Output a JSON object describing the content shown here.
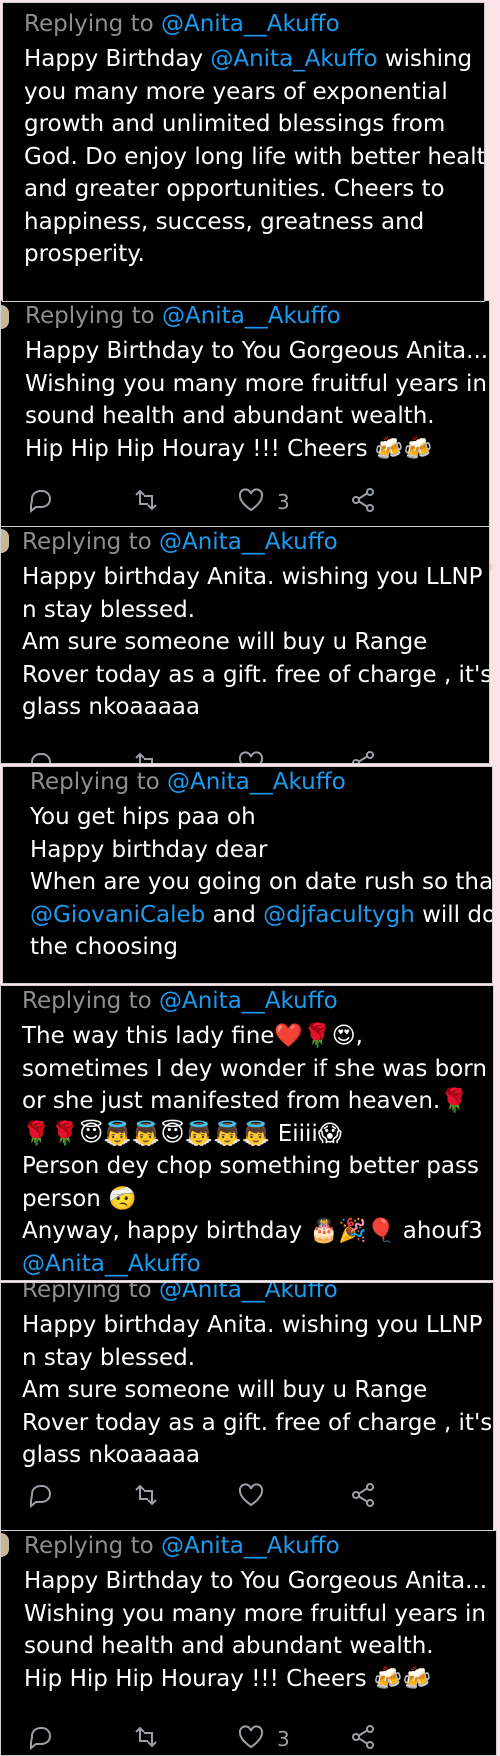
{
  "reply_prefix": "Replying to",
  "tweets": [
    {
      "handle": "@Anita__Akuffo",
      "lines": [
        [
          {
            "t": "Happy Birthday "
          },
          {
            "t": "@Anita_Akuffo",
            "m": true
          },
          {
            "t": " wishing"
          }
        ],
        [
          {
            "t": "you many more years of exponential"
          }
        ],
        [
          {
            "t": "growth and unlimited blessings from"
          }
        ],
        [
          {
            "t": "God. Do enjoy long life with better health"
          }
        ],
        [
          {
            "t": "and greater opportunities. Cheers to"
          }
        ],
        [
          {
            "t": "happiness, success, greatness and"
          }
        ],
        [
          {
            "t": "prosperity."
          }
        ]
      ]
    },
    {
      "handle": "@Anita__Akuffo",
      "lines": [
        [
          {
            "t": "Happy Birthday to You Gorgeous Anita..."
          }
        ],
        [
          {
            "t": "Wishing you many more fruitful years in"
          }
        ],
        [
          {
            "t": "sound health and abundant wealth."
          }
        ],
        [
          {
            "t": "Hip Hip Hip Houray !!! Cheers 🍻🍻"
          }
        ]
      ],
      "like_count": "3"
    },
    {
      "handle": "@Anita__Akuffo",
      "lines": [
        [
          {
            "t": "Happy birthday Anita. wishing you LLNP"
          }
        ],
        [
          {
            "t": "n stay blessed."
          }
        ],
        [
          {
            "t": "Am sure someone will buy u Range"
          }
        ],
        [
          {
            "t": "Rover today as a gift. free of charge , it's"
          }
        ],
        [
          {
            "t": "glass nkoaaaaa"
          }
        ]
      ]
    },
    {
      "handle": "@Anita__Akuffo",
      "lines": [
        [
          {
            "t": "You get hips paa oh"
          }
        ],
        [
          {
            "t": "Happy birthday dear"
          }
        ],
        [
          {
            "t": "When are you going on date rush so that"
          }
        ],
        [
          {
            "t": "@GiovaniCaleb",
            "m": true
          },
          {
            "t": " and "
          },
          {
            "t": "@djfacultygh",
            "m": true
          },
          {
            "t": " will do"
          }
        ],
        [
          {
            "t": "the choosing"
          }
        ]
      ]
    },
    {
      "handle": "@Anita__Akuffo",
      "lines": [
        [
          {
            "t": "The way this lady fine❤️🌹😍,"
          }
        ],
        [
          {
            "t": "sometimes I dey wonder if she was born"
          }
        ],
        [
          {
            "t": "or she just manifested from heaven.🌹"
          }
        ],
        [
          {
            "t": "🌹🌹😇👼👼😇👼👼👼 Eiiii😱"
          }
        ],
        [
          {
            "t": "Person dey chop something better pass"
          }
        ],
        [
          {
            "t": "person 🤕"
          }
        ],
        [
          {
            "t": "Anyway, happy birthday 🎂🎉🎈 ahouf3"
          }
        ],
        [
          {
            "t": "@Anita__Akuffo",
            "m": true
          }
        ]
      ]
    },
    {
      "handle": "@Anita__Akuffo",
      "lines": [
        [
          {
            "t": "Happy birthday Anita. wishing you LLNP"
          }
        ],
        [
          {
            "t": "n stay blessed."
          }
        ],
        [
          {
            "t": "Am sure someone will buy u Range"
          }
        ],
        [
          {
            "t": "Rover today as a gift. free of charge , it's"
          }
        ],
        [
          {
            "t": "glass nkoaaaaa"
          }
        ]
      ]
    },
    {
      "handle": "@Anita__Akuffo",
      "lines": [
        [
          {
            "t": "Happy Birthday to You Gorgeous Anita..."
          }
        ],
        [
          {
            "t": "Wishing you many more fruitful years in"
          }
        ],
        [
          {
            "t": "sound health and abundant wealth."
          }
        ],
        [
          {
            "t": "Hip Hip Hip Houray !!! Cheers 🍻🍻"
          }
        ]
      ],
      "like_count": "3"
    }
  ]
}
